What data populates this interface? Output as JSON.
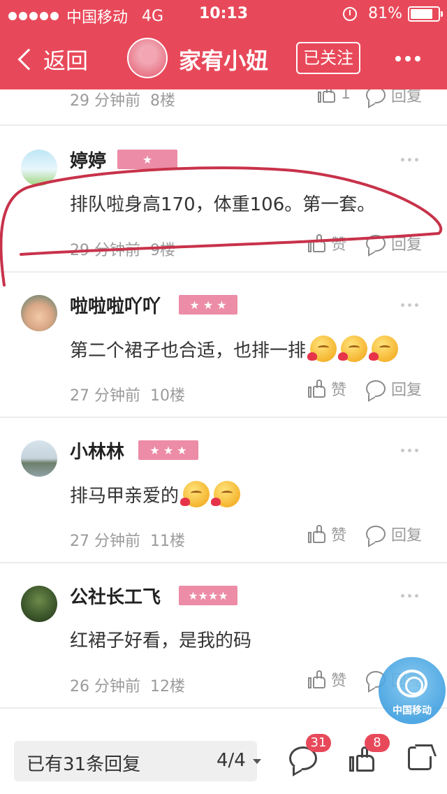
{
  "status_bar": {
    "carrier": "中国移动",
    "network": "4G",
    "time": "10:13",
    "battery": "81%",
    "battery_level": 0.81
  },
  "nav": {
    "back_label": "返回",
    "title": "家宥小妞",
    "follow_label": "已关注"
  },
  "partial_row": {
    "time": "29 分钟前",
    "floor": "8楼",
    "likes": "1",
    "reply_label": "回复"
  },
  "comments": [
    {
      "name": "婷婷",
      "stars": "★",
      "text": "排队啦身高170，体重106。第一套。",
      "emoji_count": 0,
      "time": "29 分钟前",
      "floor": "9楼",
      "like_label": "赞",
      "reply_label": "回复"
    },
    {
      "name": "啦啦啦吖吖",
      "stars": "★ ★ ★",
      "text": "第二个裙子也合适，也排一排",
      "emoji_count": 3,
      "time": "27 分钟前",
      "floor": "10楼",
      "like_label": "赞",
      "reply_label": "回复"
    },
    {
      "name": "小林林",
      "stars": "★ ★ ★",
      "text": "排马甲亲爱的",
      "emoji_count": 2,
      "time": "27 分钟前",
      "floor": "11楼",
      "like_label": "赞",
      "reply_label": "回复"
    },
    {
      "name": "公社长工飞",
      "stars": "★★★★",
      "text": "红裙子好看，是我的码",
      "emoji_count": 0,
      "time": "26 分钟前",
      "floor": "12楼",
      "like_label": "赞",
      "reply_label": "回复"
    }
  ],
  "floating_badge": {
    "label": "中国移动"
  },
  "bottom_bar": {
    "reply_summary": "已有31条回复",
    "page": "4/4",
    "comment_count": "31",
    "like_count": "8"
  },
  "colors": {
    "brand": "#e8495a",
    "badge": "#ec8ca6",
    "meta_text": "#9a9a9a"
  }
}
